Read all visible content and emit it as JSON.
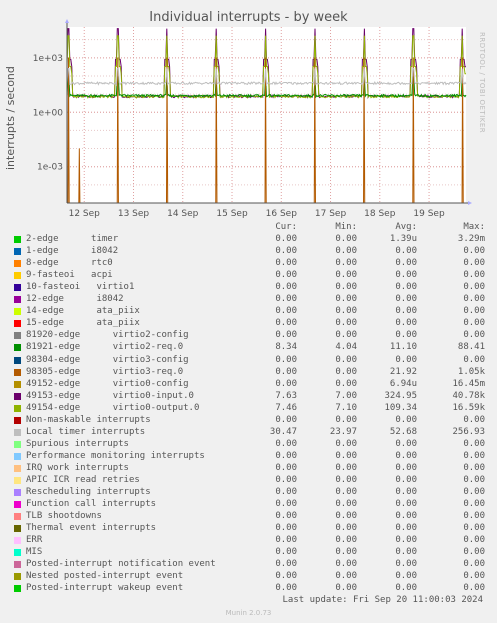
{
  "title": "Individual interrupts - by week",
  "side_label": "RRDTOOL / TOBI OETIKER",
  "ylabel": "interrupts / second",
  "footer": "Munin 2.0.73",
  "last_update": "Last update: Fri Sep 20 11:00:03 2024",
  "columns": [
    "Cur:",
    "Min:",
    "Avg:",
    "Max:"
  ],
  "legend": [
    {
      "name": "2-edge      timer",
      "color": "#00cc00",
      "cur": "0.00",
      "min": "0.00",
      "avg": "1.39u",
      "max": "3.29m"
    },
    {
      "name": "1-edge      i8042",
      "color": "#0066b3",
      "cur": "0.00",
      "min": "0.00",
      "avg": "0.00",
      "max": "0.00"
    },
    {
      "name": "8-edge      rtc0",
      "color": "#ff8000",
      "cur": "0.00",
      "min": "0.00",
      "avg": "0.00",
      "max": "0.00"
    },
    {
      "name": "9-fasteoi   acpi",
      "color": "#ffcc00",
      "cur": "0.00",
      "min": "0.00",
      "avg": "0.00",
      "max": "0.00"
    },
    {
      "name": "10-fasteoi   virtio1",
      "color": "#330099",
      "cur": "0.00",
      "min": "0.00",
      "avg": "0.00",
      "max": "0.00"
    },
    {
      "name": "12-edge      i8042",
      "color": "#990099",
      "cur": "0.00",
      "min": "0.00",
      "avg": "0.00",
      "max": "0.00"
    },
    {
      "name": "14-edge      ata_piix",
      "color": "#ccff00",
      "cur": "0.00",
      "min": "0.00",
      "avg": "0.00",
      "max": "0.00"
    },
    {
      "name": "15-edge      ata_piix",
      "color": "#ff0000",
      "cur": "0.00",
      "min": "0.00",
      "avg": "0.00",
      "max": "0.00"
    },
    {
      "name": "81920-edge      virtio2-config",
      "color": "#808080",
      "cur": "0.00",
      "min": "0.00",
      "avg": "0.00",
      "max": "0.00"
    },
    {
      "name": "81921-edge      virtio2-req.0",
      "color": "#008f00",
      "cur": "8.34",
      "min": "4.04",
      "avg": "11.10",
      "max": "88.41"
    },
    {
      "name": "98304-edge      virtio3-config",
      "color": "#00487d",
      "cur": "0.00",
      "min": "0.00",
      "avg": "0.00",
      "max": "0.00"
    },
    {
      "name": "98305-edge      virtio3-req.0",
      "color": "#b35a00",
      "cur": "0.00",
      "min": "0.00",
      "avg": "21.92",
      "max": "1.05k"
    },
    {
      "name": "49152-edge      virtio0-config",
      "color": "#b38f00",
      "cur": "0.00",
      "min": "0.00",
      "avg": "6.94u",
      "max": "16.45m"
    },
    {
      "name": "49153-edge      virtio0-input.0",
      "color": "#6b006b",
      "cur": "7.63",
      "min": "7.00",
      "avg": "324.95",
      "max": "40.78k"
    },
    {
      "name": "49154-edge      virtio0-output.0",
      "color": "#8fb300",
      "cur": "7.46",
      "min": "7.10",
      "avg": "109.34",
      "max": "16.59k"
    },
    {
      "name": "Non-maskable interrupts",
      "color": "#b30000",
      "cur": "0.00",
      "min": "0.00",
      "avg": "0.00",
      "max": "0.00"
    },
    {
      "name": "Local timer interrupts",
      "color": "#bebebe",
      "cur": "30.47",
      "min": "23.97",
      "avg": "52.68",
      "max": "256.93"
    },
    {
      "name": "Spurious interrupts",
      "color": "#80ff80",
      "cur": "0.00",
      "min": "0.00",
      "avg": "0.00",
      "max": "0.00"
    },
    {
      "name": "Performance monitoring interrupts",
      "color": "#80c9ff",
      "cur": "0.00",
      "min": "0.00",
      "avg": "0.00",
      "max": "0.00"
    },
    {
      "name": "IRQ work interrupts",
      "color": "#ffc080",
      "cur": "0.00",
      "min": "0.00",
      "avg": "0.00",
      "max": "0.00"
    },
    {
      "name": "APIC ICR read retries",
      "color": "#ffe680",
      "cur": "0.00",
      "min": "0.00",
      "avg": "0.00",
      "max": "0.00"
    },
    {
      "name": "Rescheduling interrupts",
      "color": "#aa80ff",
      "cur": "0.00",
      "min": "0.00",
      "avg": "0.00",
      "max": "0.00"
    },
    {
      "name": "Function call interrupts",
      "color": "#ee00cc",
      "cur": "0.00",
      "min": "0.00",
      "avg": "0.00",
      "max": "0.00"
    },
    {
      "name": "TLB shootdowns",
      "color": "#ff8080",
      "cur": "0.00",
      "min": "0.00",
      "avg": "0.00",
      "max": "0.00"
    },
    {
      "name": "Thermal event interrupts",
      "color": "#666600",
      "cur": "0.00",
      "min": "0.00",
      "avg": "0.00",
      "max": "0.00"
    },
    {
      "name": "ERR",
      "color": "#ffbfff",
      "cur": "0.00",
      "min": "0.00",
      "avg": "0.00",
      "max": "0.00"
    },
    {
      "name": "MIS",
      "color": "#00ffcc",
      "cur": "0.00",
      "min": "0.00",
      "avg": "0.00",
      "max": "0.00"
    },
    {
      "name": "Posted-interrupt notification event",
      "color": "#cc6699",
      "cur": "0.00",
      "min": "0.00",
      "avg": "0.00",
      "max": "0.00"
    },
    {
      "name": "Nested posted-interrupt event",
      "color": "#999900",
      "cur": "0.00",
      "min": "0.00",
      "avg": "0.00",
      "max": "0.00"
    },
    {
      "name": "Posted-interrupt wakeup event",
      "color": "#00cc00",
      "cur": "0.00",
      "min": "0.00",
      "avg": "0.00",
      "max": "0.00"
    }
  ],
  "chart_data": {
    "type": "line",
    "title": "Individual interrupts - by week",
    "ylabel": "interrupts / second",
    "yscale": "log",
    "ylim": [
      1e-05,
      50000
    ],
    "yticks": [
      {
        "v": 0.001,
        "label": "1e-03"
      },
      {
        "v": 1,
        "label": "1e+00"
      },
      {
        "v": 1000,
        "label": "1e+03"
      }
    ],
    "xlim": [
      0,
      8.1
    ],
    "xticks": [
      {
        "v": 0.35,
        "label": "12 Sep"
      },
      {
        "v": 1.35,
        "label": "13 Sep"
      },
      {
        "v": 2.35,
        "label": "14 Sep"
      },
      {
        "v": 3.35,
        "label": "15 Sep"
      },
      {
        "v": 4.35,
        "label": "16 Sep"
      },
      {
        "v": 5.35,
        "label": "17 Sep"
      },
      {
        "v": 6.35,
        "label": "18 Sep"
      },
      {
        "v": 7.35,
        "label": "19 Sep"
      }
    ],
    "grid": true,
    "spike_days": [
      0.03,
      1.03,
      2.03,
      3.03,
      4.03,
      5.03,
      6.03,
      7.03,
      8.03
    ],
    "series": [
      {
        "name": "49153-edge virtio0-input.0",
        "color": "#6b006b",
        "baseline": 7.5,
        "peak": 40780
      },
      {
        "name": "49154-edge virtio0-output.0",
        "color": "#8fb300",
        "baseline": 7.3,
        "peak": 16590
      },
      {
        "name": "81921-edge virtio2-req.0",
        "color": "#008f00",
        "baseline": 8.3,
        "peak": 88.41
      },
      {
        "name": "98305-edge virtio3-req.0",
        "color": "#b35a00",
        "baseline": 0,
        "peak": 1050
      },
      {
        "name": "Local timer interrupts",
        "color": "#bebebe",
        "baseline": 40,
        "peak": 256.93
      }
    ]
  }
}
